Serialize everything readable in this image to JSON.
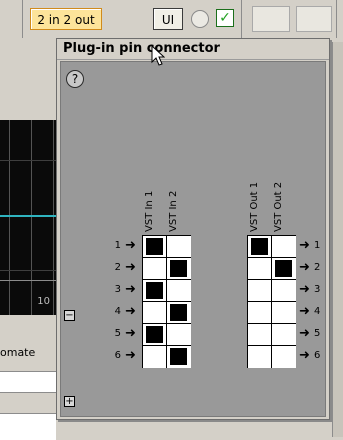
{
  "toolbar": {
    "io_button_label": "2 in 2 out",
    "ui_button_label": "UI",
    "checkbox_glyph": "✓"
  },
  "track": {
    "marker_number": "10"
  },
  "host": {
    "automation_label": "omate"
  },
  "plugin_window": {
    "title": "Plug-in pin connector",
    "help_glyph": "?",
    "input_columns": [
      "VST In 1",
      "VST In 2"
    ],
    "output_columns": [
      "VST Out 1",
      "VST Out 2"
    ],
    "rows": [
      {
        "in_label": "1",
        "out_label": "1",
        "inputs": [
          true,
          false
        ],
        "outputs": [
          true,
          false
        ]
      },
      {
        "in_label": "2",
        "out_label": "2",
        "inputs": [
          false,
          true
        ],
        "outputs": [
          false,
          true
        ]
      },
      {
        "in_label": "3",
        "out_label": "3",
        "inputs": [
          true,
          false
        ],
        "outputs": [
          false,
          false
        ]
      },
      {
        "in_label": "4",
        "out_label": "4",
        "inputs": [
          false,
          true
        ],
        "outputs": [
          false,
          false
        ]
      },
      {
        "in_label": "5",
        "out_label": "5",
        "inputs": [
          true,
          false
        ],
        "outputs": [
          false,
          false
        ]
      },
      {
        "in_label": "6",
        "out_label": "6",
        "inputs": [
          false,
          true
        ],
        "outputs": [
          false,
          false
        ]
      }
    ],
    "collapse_glyph": "−",
    "expand_glyph": "+",
    "arrow_glyph": "➜"
  },
  "colors": {
    "window_bg": "#d4d0c8",
    "content_bg": "#999999",
    "active_button_bg": "#fde49a",
    "track_cyan": "#2fb4c0",
    "checkbox_green": "#21a121"
  },
  "icons": {
    "help": "question-circle-icon",
    "collapse": "minus-box-icon",
    "expand": "plus-box-icon",
    "arrow": "right-arrow-icon",
    "cursor": "mouse-pointer-icon"
  }
}
